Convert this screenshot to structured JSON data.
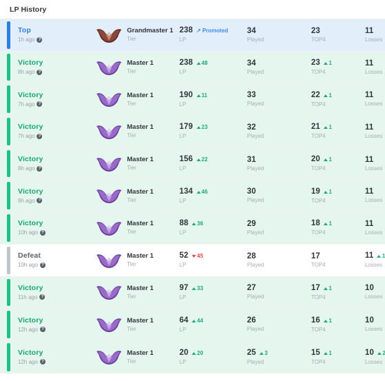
{
  "header": {
    "title": "LP History"
  },
  "labels": {
    "tier": "Tier",
    "lp": "LP",
    "played": "Played",
    "top4": "TOP4",
    "losses": "Losses",
    "info_icon": "info-icon",
    "promoted_icon": "promoted-arrow-icon"
  },
  "colors": {
    "victory_text": "#17a673",
    "victory_bar": "#1fbf86",
    "victory_bg": "#e4f6ee",
    "top_text": "#2f7fe0",
    "top_bar": "#2b7de0",
    "top_bg": "#e3eefb",
    "defeat_text": "#5b6168",
    "defeat_bar": "#bfc4c9",
    "defeat_bg": "#ffffff",
    "delta_up": "#1fa97f",
    "delta_down": "#e8454a",
    "promoted": "#3d8bf2",
    "grandmaster_emblem": "#7a3b2e",
    "master_emblem": "#8a5fbe"
  },
  "rows": [
    {
      "status": "Top",
      "status_type": "top",
      "time": "1h ago",
      "emblem": "grandmaster-emblem",
      "tier": "Grandmaster 1",
      "lp": "238",
      "lp_delta": "",
      "lp_delta_dir": "",
      "promoted": "Promoted",
      "played": "34",
      "played_delta": "",
      "played_delta_dir": "",
      "top4": "23",
      "top4_delta": "",
      "top4_delta_dir": "",
      "losses": "11",
      "losses_delta": "",
      "losses_delta_dir": ""
    },
    {
      "status": "Victory",
      "status_type": "victory",
      "time": "8h ago",
      "emblem": "master-emblem",
      "tier": "Master 1",
      "lp": "238",
      "lp_delta": "48",
      "lp_delta_dir": "up",
      "promoted": "",
      "played": "34",
      "played_delta": "",
      "played_delta_dir": "",
      "top4": "23",
      "top4_delta": "1",
      "top4_delta_dir": "up",
      "losses": "11",
      "losses_delta": "",
      "losses_delta_dir": ""
    },
    {
      "status": "Victory",
      "status_type": "victory",
      "time": "7h ago",
      "emblem": "master-emblem",
      "tier": "Master 1",
      "lp": "190",
      "lp_delta": "11",
      "lp_delta_dir": "up",
      "promoted": "",
      "played": "33",
      "played_delta": "",
      "played_delta_dir": "",
      "top4": "22",
      "top4_delta": "1",
      "top4_delta_dir": "up",
      "losses": "11",
      "losses_delta": "",
      "losses_delta_dir": ""
    },
    {
      "status": "Victory",
      "status_type": "victory",
      "time": "7h ago",
      "emblem": "master-emblem",
      "tier": "Master 1",
      "lp": "179",
      "lp_delta": "23",
      "lp_delta_dir": "up",
      "promoted": "",
      "played": "32",
      "played_delta": "",
      "played_delta_dir": "",
      "top4": "21",
      "top4_delta": "1",
      "top4_delta_dir": "up",
      "losses": "11",
      "losses_delta": "",
      "losses_delta_dir": ""
    },
    {
      "status": "Victory",
      "status_type": "victory",
      "time": "8h ago",
      "emblem": "master-emblem",
      "tier": "Master 1",
      "lp": "156",
      "lp_delta": "22",
      "lp_delta_dir": "up",
      "promoted": "",
      "played": "31",
      "played_delta": "",
      "played_delta_dir": "",
      "top4": "20",
      "top4_delta": "1",
      "top4_delta_dir": "up",
      "losses": "11",
      "losses_delta": "",
      "losses_delta_dir": ""
    },
    {
      "status": "Victory",
      "status_type": "victory",
      "time": "9h ago",
      "emblem": "master-emblem",
      "tier": "Master 1",
      "lp": "134",
      "lp_delta": "46",
      "lp_delta_dir": "up",
      "promoted": "",
      "played": "30",
      "played_delta": "",
      "played_delta_dir": "",
      "top4": "19",
      "top4_delta": "1",
      "top4_delta_dir": "up",
      "losses": "11",
      "losses_delta": "",
      "losses_delta_dir": ""
    },
    {
      "status": "Victory",
      "status_type": "victory",
      "time": "10h ago",
      "emblem": "master-emblem",
      "tier": "Master 1",
      "lp": "88",
      "lp_delta": "36",
      "lp_delta_dir": "up",
      "promoted": "",
      "played": "29",
      "played_delta": "",
      "played_delta_dir": "",
      "top4": "18",
      "top4_delta": "1",
      "top4_delta_dir": "up",
      "losses": "11",
      "losses_delta": "",
      "losses_delta_dir": ""
    },
    {
      "status": "Defeat",
      "status_type": "defeat",
      "time": "10h ago",
      "emblem": "master-emblem",
      "tier": "Master 1",
      "lp": "52",
      "lp_delta": "45",
      "lp_delta_dir": "down",
      "promoted": "",
      "played": "28",
      "played_delta": "",
      "played_delta_dir": "",
      "top4": "17",
      "top4_delta": "",
      "top4_delta_dir": "",
      "losses": "11",
      "losses_delta": "1",
      "losses_delta_dir": "up"
    },
    {
      "status": "Victory",
      "status_type": "victory",
      "time": "11h ago",
      "emblem": "master-emblem",
      "tier": "Master 1",
      "lp": "97",
      "lp_delta": "33",
      "lp_delta_dir": "up",
      "promoted": "",
      "played": "27",
      "played_delta": "",
      "played_delta_dir": "",
      "top4": "17",
      "top4_delta": "1",
      "top4_delta_dir": "up",
      "losses": "10",
      "losses_delta": "",
      "losses_delta_dir": ""
    },
    {
      "status": "Victory",
      "status_type": "victory",
      "time": "12h ago",
      "emblem": "master-emblem",
      "tier": "Master 1",
      "lp": "64",
      "lp_delta": "44",
      "lp_delta_dir": "up",
      "promoted": "",
      "played": "26",
      "played_delta": "",
      "played_delta_dir": "",
      "top4": "16",
      "top4_delta": "1",
      "top4_delta_dir": "up",
      "losses": "10",
      "losses_delta": "",
      "losses_delta_dir": ""
    },
    {
      "status": "Victory",
      "status_type": "victory",
      "time": "12h ago",
      "emblem": "master-emblem",
      "tier": "Master 1",
      "lp": "20",
      "lp_delta": "20",
      "lp_delta_dir": "up",
      "promoted": "",
      "played": "25",
      "played_delta": "3",
      "played_delta_dir": "up",
      "top4": "15",
      "top4_delta": "1",
      "top4_delta_dir": "up",
      "losses": "10",
      "losses_delta": "2",
      "losses_delta_dir": "up"
    }
  ]
}
